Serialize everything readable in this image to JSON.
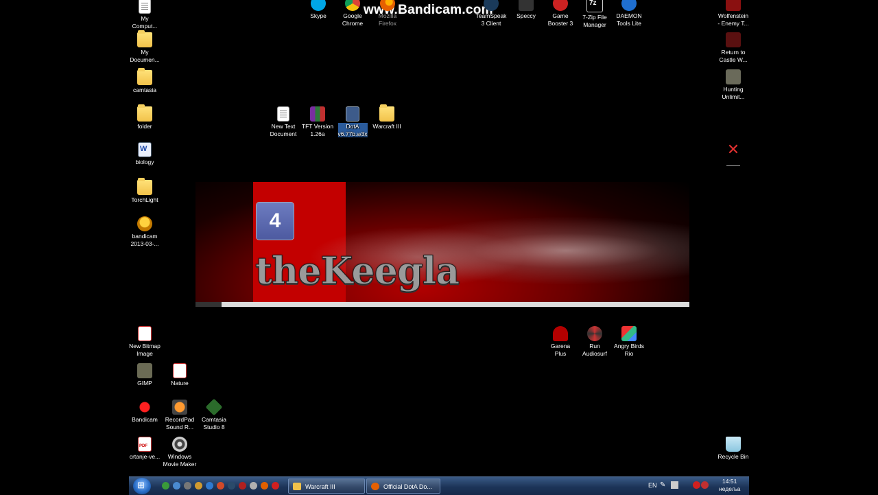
{
  "watermark": "www.Bandicam.com",
  "desktop_icons_left": [
    {
      "name": "my-computer",
      "label": "My\nComput...",
      "icon": "computer-icon"
    },
    {
      "name": "my-documents",
      "label": "My\nDocumen...",
      "icon": "documents-icon"
    },
    {
      "name": "camtasia-folder",
      "label": "camtasia",
      "icon": "folder-icon"
    },
    {
      "name": "folder",
      "label": "folder",
      "icon": "folder-icon"
    },
    {
      "name": "biology",
      "label": "biology",
      "icon": "word-doc-icon"
    },
    {
      "name": "torchlight",
      "label": "TorchLight",
      "icon": "folder-icon"
    },
    {
      "name": "bandicam-avi",
      "label": "bandicam\n2013-03-...",
      "icon": "avi-icon"
    },
    {
      "name": "new-bitmap",
      "label": "New Bitmap\nImage",
      "icon": "bitmap-icon"
    },
    {
      "name": "gimp",
      "label": "GIMP",
      "icon": "gimp-icon"
    },
    {
      "name": "nature",
      "label": "Nature",
      "icon": "nature-icon"
    },
    {
      "name": "bandicam",
      "label": "Bandicam",
      "icon": "bandicam-icon"
    },
    {
      "name": "recordpad",
      "label": "RecordPad\nSound R...",
      "icon": "recordpad-icon"
    },
    {
      "name": "camtasia-studio",
      "label": "Camtasia\nStudio 8",
      "icon": "camtasia-icon"
    },
    {
      "name": "ortanje",
      "label": "crtanje-ve...",
      "icon": "pdf-icon"
    },
    {
      "name": "movie-maker",
      "label": "Windows\nMovie Maker",
      "icon": "movie-maker-icon"
    }
  ],
  "desktop_icons_top": [
    {
      "name": "skype",
      "label": "Skype"
    },
    {
      "name": "chrome",
      "label": "Google\nChrome"
    },
    {
      "name": "firefox",
      "label": "Mozilla\nFirefox"
    },
    {
      "name": "teamspeak",
      "label": "TeamSpeak\n3 Client"
    },
    {
      "name": "speccy",
      "label": "Speccy"
    },
    {
      "name": "game-booster",
      "label": "Game\nBooster 3"
    },
    {
      "name": "7zip",
      "label": "7-Zip File\nManager"
    },
    {
      "name": "daemon",
      "label": "DAEMON\nTools Lite"
    }
  ],
  "desktop_icons_right": [
    {
      "name": "wolfenstein",
      "label": "Wolfenstein\n- Enemy T..."
    },
    {
      "name": "return-castle",
      "label": "Return to\nCastle W..."
    },
    {
      "name": "hunting",
      "label": "Hunting\nUnlimit..."
    },
    {
      "name": "recycle-bin",
      "label": "Recycle Bin"
    }
  ],
  "desktop_icons_middle": [
    {
      "name": "new-text-document",
      "label": "New Text\nDocument"
    },
    {
      "name": "tft-version",
      "label": "TFT Version\n1.26a"
    },
    {
      "name": "dota-map",
      "label": "DotA\nv6.77b.w3x",
      "selected": true
    },
    {
      "name": "warcraft-folder",
      "label": "Warcraft III"
    }
  ],
  "desktop_icons_games": [
    {
      "name": "garena",
      "label": "Garena\nPlus"
    },
    {
      "name": "audiosurf",
      "label": "Run\nAudiosurf"
    },
    {
      "name": "angry-birds",
      "label": "Angry Birds\nRio"
    }
  ],
  "wallpaper": {
    "logo_text": "theKeegla",
    "badge_text": "4"
  },
  "taskbar": {
    "tasks": [
      {
        "label": "Warcraft III"
      },
      {
        "label": "Official DotA Do..."
      }
    ],
    "language": "EN",
    "time": "14:51",
    "day": "недеља"
  },
  "colors": {
    "taskbar": "#1c3458",
    "wallpaper_red": "#c30000",
    "selection": "#2a5b9c"
  }
}
